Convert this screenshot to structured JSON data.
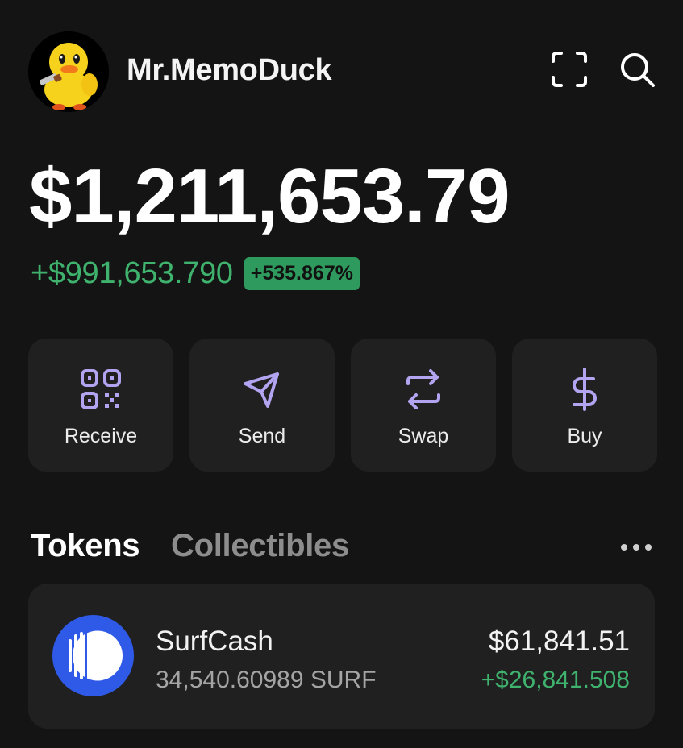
{
  "header": {
    "username": "Mr.MemoDuck",
    "scan_icon": "scan-icon",
    "search_icon": "search-icon"
  },
  "balance": {
    "total": "$1,211,653.79",
    "change_amount": "+$991,653.790",
    "change_percent": "+535.867%"
  },
  "actions": [
    {
      "label": "Receive",
      "icon": "qr-code-icon"
    },
    {
      "label": "Send",
      "icon": "paper-plane-icon"
    },
    {
      "label": "Swap",
      "icon": "swap-arrows-icon"
    },
    {
      "label": "Buy",
      "icon": "dollar-icon"
    }
  ],
  "tabs": {
    "tokens": "Tokens",
    "collectibles": "Collectibles"
  },
  "tokens": [
    {
      "name": "SurfCash",
      "quantity": "34,540.60989 SURF",
      "value": "$61,841.51",
      "gain": "+$26,841.508"
    }
  ],
  "colors": {
    "background": "#141414",
    "card": "#202020",
    "positive": "#3fb26e",
    "accent_icon": "#b3a4f2",
    "token_brand": "#2f5ae8"
  }
}
